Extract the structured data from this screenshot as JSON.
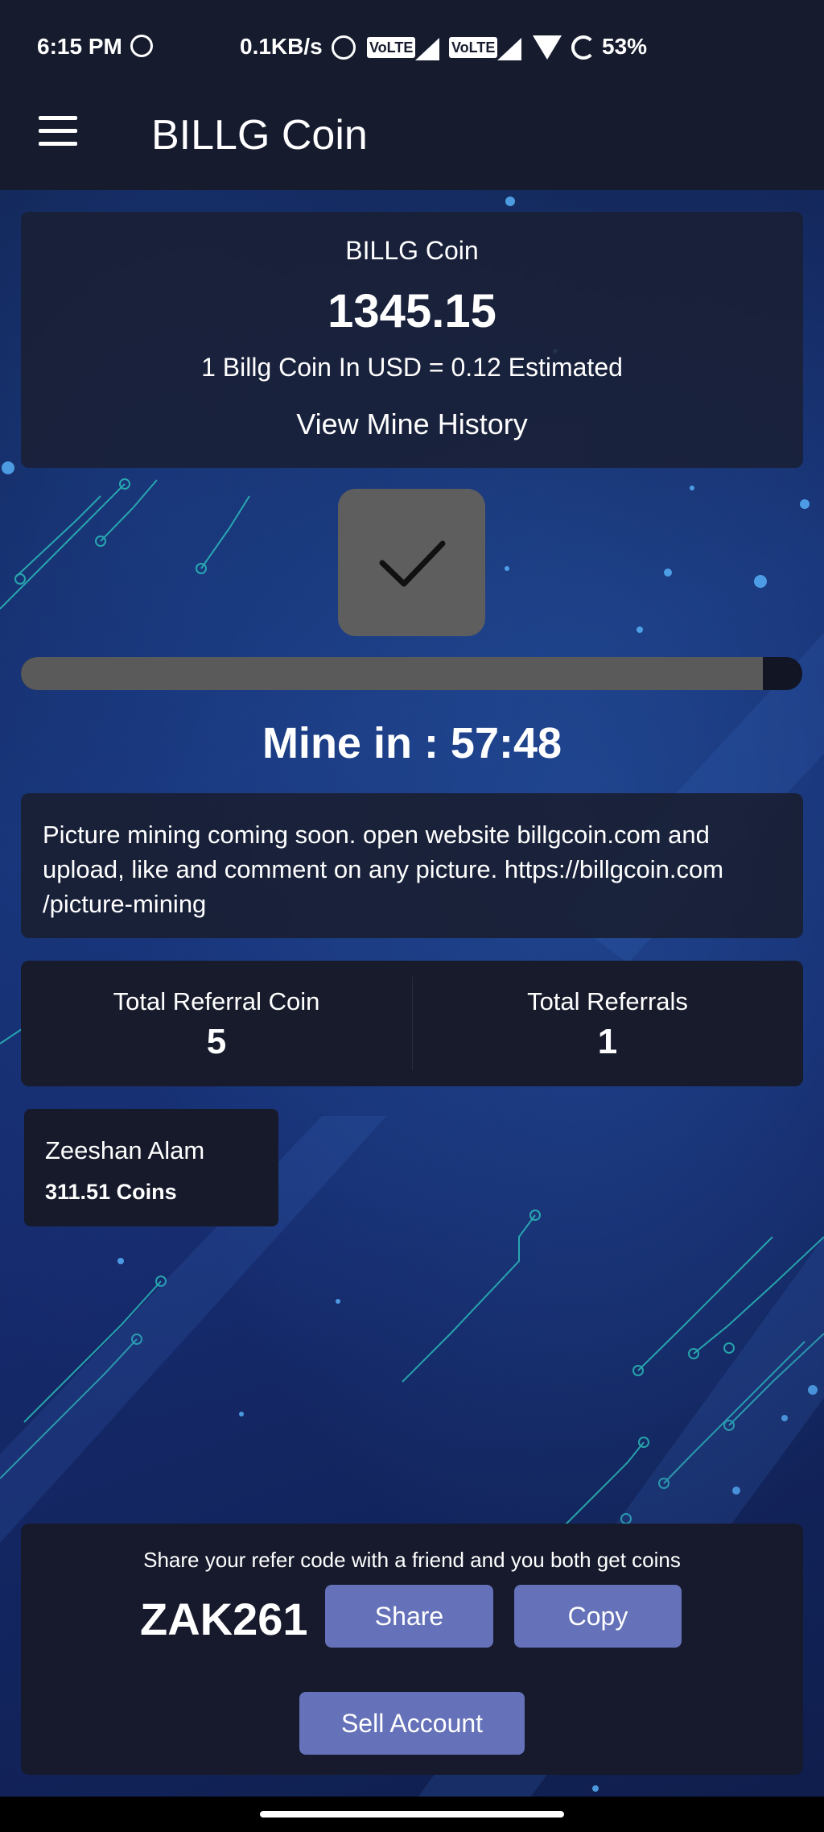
{
  "status_bar": {
    "time": "6:15 PM",
    "network_speed": "0.1KB/s",
    "volte_1": "VoLTE",
    "volte_2": "VoLTE",
    "battery": "53%",
    "icons": [
      "whatsapp-icon",
      "alarm-icon",
      "signal-icon",
      "wifi-icon",
      "battery-icon"
    ]
  },
  "app_bar": {
    "title": "BILLG Coin",
    "menu_icon": "hamburger-icon"
  },
  "balance": {
    "coin_name": "BILLG Coin",
    "amount": "1345.15",
    "rate_text": "1 Billg Coin In USD = 0.12 Estimated",
    "history_link": "View Mine History"
  },
  "mining": {
    "button_icon": "checkmark-icon",
    "progress_fraction": 0.95,
    "timer_text": "Mine in : 57:48"
  },
  "notice": {
    "text": "Picture mining coming soon. open website billgcoin.com and upload, like and comment on any picture. https://billgcoin.com /picture-mining"
  },
  "referrals": {
    "total_coin_label": "Total Referral Coin",
    "total_coin_value": "5",
    "total_referrals_label": "Total Referrals",
    "total_referrals_value": "1",
    "members": [
      {
        "name": "Zeeshan Alam",
        "coins": "311.51 Coins"
      }
    ]
  },
  "refer": {
    "message": "Share your refer code with a friend and you both get coins",
    "code": "ZAK261",
    "share_label": "Share",
    "copy_label": "Copy",
    "sell_label": "Sell Account"
  },
  "colors": {
    "background": "#151a2d",
    "card": "#1a1f32",
    "button": "#6571b8",
    "mine_button": "#5e5e5e"
  }
}
